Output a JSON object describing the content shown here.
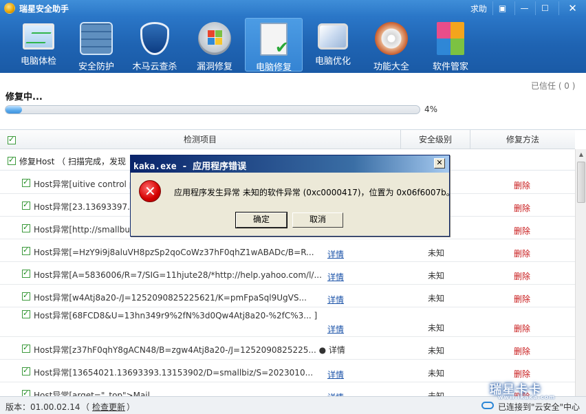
{
  "app": {
    "title": "瑞星安全助手",
    "help": "求助"
  },
  "window_buttons": {
    "menu": "▣",
    "minimize": "—",
    "maximize": "☐",
    "close": "✕"
  },
  "toolbar": [
    {
      "label": "电脑体检",
      "icon": "monitor-check-icon"
    },
    {
      "label": "安全防护",
      "icon": "firewall-icon"
    },
    {
      "label": "木马云查杀",
      "icon": "shield-icon"
    },
    {
      "label": "漏洞修复",
      "icon": "windows-patch-icon"
    },
    {
      "label": "电脑修复",
      "icon": "clipboard-check-icon",
      "active": true
    },
    {
      "label": "电脑优化",
      "icon": "display-brush-icon"
    },
    {
      "label": "功能大全",
      "icon": "disc-box-icon"
    },
    {
      "label": "软件管家",
      "icon": "software-blocks-icon"
    }
  ],
  "status": {
    "trusted": "已信任 ( 0 )",
    "text": "修复中...",
    "progress_percent": 4,
    "progress_label": "4%"
  },
  "table": {
    "headers": [
      "检测项目",
      "安全级别",
      "修复方法"
    ],
    "group": {
      "label": "修复Host （ 扫描完成，发现"
    },
    "rows": [
      {
        "text": "Host异常[uitive control pa",
        "detail": "",
        "level": "",
        "fix": "删除"
      },
      {
        "text": "Host异常[23.13693397.13",
        "detail": "",
        "level": "",
        "fix": "删除"
      },
      {
        "text": "Host异常[http://smallbusin",
        "detail": "",
        "level": "",
        "fix": "删除"
      },
      {
        "text": "Host异常[=HzY9i9j8aluVH8pzSp2qoCoWz37hF0qhZ1wABADc/B=R...",
        "detail": "详情",
        "level": "未知",
        "fix": "删除"
      },
      {
        "text": "Host异常[A=5836006/R=7/SIG=11hjute28/*http://help.yahoo.com/l/...",
        "detail": "详情",
        "level": "未知",
        "fix": "删除"
      },
      {
        "text": "Host异常[w4Atj8a20-/J=1252090825225621/K=pmFpaSql9UgVS...",
        "detail": "详情",
        "level": "未知",
        "fix": "删除"
      },
      {
        "text": "Host异常[68FCD8&U=13hn349r9%2fN%3d0Qw4Atj8a20-%2fC%3... ]",
        "detail": "详情",
        "level": "未知",
        "fix": "删除"
      },
      {
        "text": "Host异常[z37hF0qhY8gACN48/B=zgw4Atj8a20-/J=1252090825225... ●  详情",
        "detail": "",
        "level": "未知",
        "fix": "删除"
      },
      {
        "text": "Host异常[13654021.13693393.13153902/D=smallbiz/S=2023010...",
        "detail": "详情",
        "level": "未知",
        "fix": "删除"
      },
      {
        "text": "Host异常[arget=\"_top\">Mail",
        "detail": "详情",
        "level": "未知",
        "fix": "删除"
      }
    ]
  },
  "footer": {
    "version": "版本：01.00.02.14",
    "check_update": "检查更新",
    "open_paren": "（",
    "close_paren": "）",
    "cloud_status": "已连接到\"云安全\"中心"
  },
  "watermark": {
    "text": "瑞星卡卡",
    "url": "www.ikaka.com"
  },
  "dialog": {
    "title": "kaka.exe - 应用程序错误",
    "message": "应用程序发生异常 未知的软件异常 (0xc0000417)，位置为 0x06f6007b。",
    "ok": "确定",
    "cancel": "取消",
    "close": "✕"
  }
}
